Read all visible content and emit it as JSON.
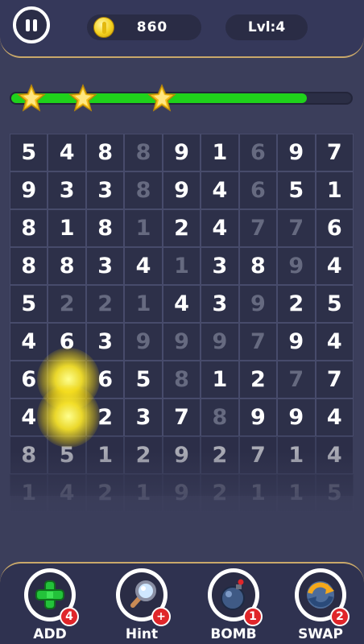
{
  "header": {
    "coins": "860",
    "level": "Lvl:4"
  },
  "progress": {
    "fraction": 0.87,
    "stars_earned": 3
  },
  "grid": [
    [
      "5",
      "4",
      "8",
      "8",
      "9",
      "1",
      "6",
      "9",
      "7"
    ],
    [
      "9",
      "3",
      "3",
      "8",
      "9",
      "4",
      "6",
      "5",
      "1"
    ],
    [
      "8",
      "1",
      "8",
      "1",
      "2",
      "4",
      "7",
      "7",
      "6"
    ],
    [
      "8",
      "8",
      "3",
      "4",
      "1",
      "3",
      "8",
      "9",
      "4"
    ],
    [
      "5",
      "2",
      "2",
      "1",
      "4",
      "3",
      "9",
      "2",
      "5"
    ],
    [
      "4",
      "6",
      "3",
      "9",
      "9",
      "9",
      "7",
      "9",
      "4"
    ],
    [
      "6",
      "",
      "6",
      "5",
      "8",
      "1",
      "2",
      "7",
      "7"
    ],
    [
      "4",
      "",
      "2",
      "3",
      "7",
      "8",
      "9",
      "9",
      "4"
    ],
    [
      "8",
      "5",
      "1",
      "2",
      "9",
      "2",
      "7",
      "1",
      "4"
    ],
    [
      "1",
      "4",
      "2",
      "1",
      "9",
      "2",
      "1",
      "1",
      "5"
    ]
  ],
  "grid_dim": [
    [
      0,
      0,
      0,
      1,
      0,
      0,
      1,
      0,
      0
    ],
    [
      0,
      0,
      0,
      1,
      0,
      0,
      1,
      0,
      0
    ],
    [
      0,
      0,
      0,
      1,
      0,
      0,
      1,
      1,
      0
    ],
    [
      0,
      0,
      0,
      0,
      1,
      0,
      0,
      1,
      0
    ],
    [
      0,
      1,
      1,
      1,
      0,
      0,
      1,
      0,
      0
    ],
    [
      0,
      0,
      0,
      1,
      1,
      1,
      1,
      0,
      0
    ],
    [
      0,
      0,
      0,
      0,
      1,
      0,
      0,
      1,
      0
    ],
    [
      0,
      0,
      0,
      0,
      0,
      1,
      0,
      0,
      0
    ],
    [
      0,
      0,
      0,
      0,
      0,
      0,
      0,
      0,
      0
    ],
    [
      0,
      0,
      0,
      0,
      0,
      0,
      0,
      0,
      0
    ]
  ],
  "tools": [
    {
      "label": "ADD",
      "badge": "4",
      "icon": "plus-icon"
    },
    {
      "label": "Hint",
      "badge": "+",
      "icon": "magnifier-icon"
    },
    {
      "label": "BOMB",
      "badge": "1",
      "icon": "bomb-icon"
    },
    {
      "label": "SWAP",
      "badge": "2",
      "icon": "swap-arrows-icon"
    }
  ],
  "colors": {
    "progress": "#1fd21b",
    "badge": "#e0262a",
    "accent_border": "#c9a86a"
  }
}
